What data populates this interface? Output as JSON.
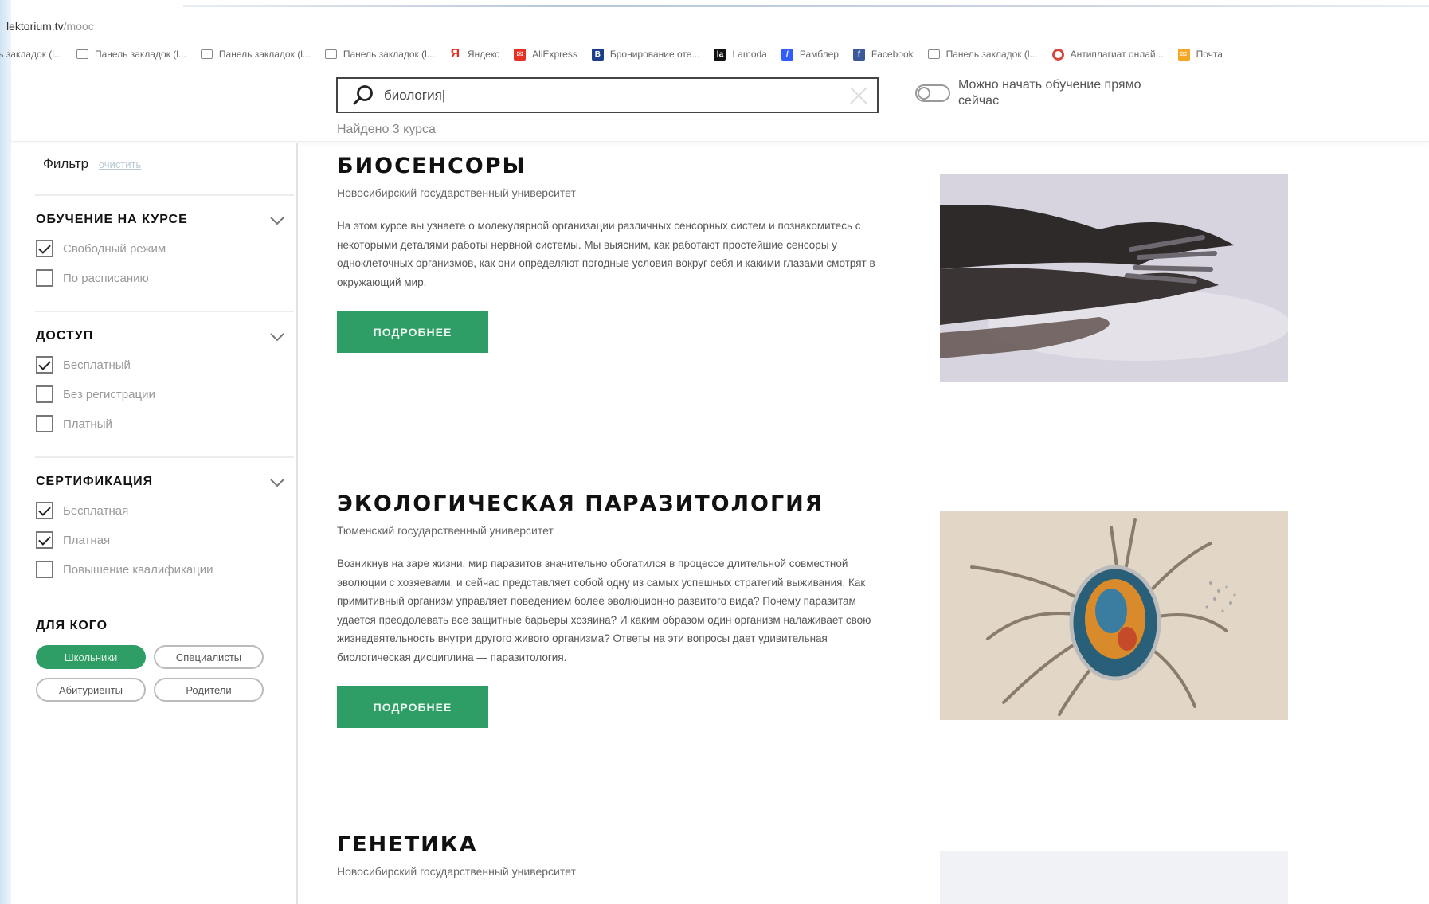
{
  "browser": {
    "url_host": "lektorium.tv",
    "url_path": "/mooc",
    "bookmarks": [
      {
        "icon": "folder-icon",
        "label": "Панель закладок (l..."
      },
      {
        "icon": "folder-icon",
        "label": "Панель закладок (l..."
      },
      {
        "icon": "folder-icon",
        "label": "Панель закладок (l..."
      },
      {
        "icon": "folder-icon",
        "label": "Панель закладок (l..."
      },
      {
        "icon": "yandex-icon",
        "label": "Яндекс"
      },
      {
        "icon": "aliexpress-icon",
        "label": "AliExpress"
      },
      {
        "icon": "booking-icon",
        "label": "Бронирование оте..."
      },
      {
        "icon": "lamoda-icon",
        "label": "Lamoda"
      },
      {
        "icon": "rambler-icon",
        "label": "Рамблер"
      },
      {
        "icon": "facebook-icon",
        "label": "Facebook"
      },
      {
        "icon": "folder-icon",
        "label": "Панель закладок (l..."
      },
      {
        "icon": "antiplagiat-icon",
        "label": "Антиплагиат онлай..."
      },
      {
        "icon": "mail-icon",
        "label": "Почта"
      }
    ]
  },
  "search": {
    "value": "биология|",
    "found_text": "Найдено 3 курса",
    "toggle_label": "Можно начать обучение прямо сейчас"
  },
  "filter": {
    "title": "Фильтр",
    "clear": "очистить",
    "sections": [
      {
        "title": "ОБУЧЕНИЕ НА КУРСЕ",
        "options": [
          {
            "label": "Свободный режим",
            "checked": true
          },
          {
            "label": "По расписанию",
            "checked": false
          }
        ]
      },
      {
        "title": "ДОСТУП",
        "options": [
          {
            "label": "Бесплатный",
            "checked": true
          },
          {
            "label": "Без регистрации",
            "checked": false
          },
          {
            "label": "Платный",
            "checked": false
          }
        ]
      },
      {
        "title": "СЕРТИФИКАЦИЯ",
        "options": [
          {
            "label": "Бесплатная",
            "checked": true
          },
          {
            "label": "Платная",
            "checked": true
          },
          {
            "label": "Повышение квалификации",
            "checked": false
          }
        ]
      }
    ],
    "audience": {
      "title": "ДЛЯ КОГО",
      "pills": [
        {
          "label": "Школьники",
          "active": true
        },
        {
          "label": "Специалисты",
          "active": false
        },
        {
          "label": "Абитуриенты",
          "active": false
        },
        {
          "label": "Родители",
          "active": false
        }
      ]
    }
  },
  "courses": [
    {
      "title": "БИОСЕНСОРЫ",
      "university": "Новосибирский государственный университет",
      "description": "На этом курсе вы узнаете о молекулярной организации различных сенсорных систем и познакомитесь с некоторыми деталями работы нервной системы. Мы выясним, как работают простейшие сенсоры у одноклеточных организмов, как они определяют погодные условия вокруг себя и какими глазами смотрят в окружающий мир.",
      "button": "ПОДРОБНЕЕ"
    },
    {
      "title": "ЭКОЛОГИЧЕСКАЯ ПАРАЗИТОЛОГИЯ",
      "university": "Тюменский государственный университет",
      "description": "Возникнув на заре жизни, мир паразитов значительно обогатился в процессе длительной совместной эволюции с хозяевами, и сейчас представляет собой одну из самых успешных стратегий выживания. Как примитивный организм управляет поведением более эволюционно развитого вида? Почему паразитам удается преодолевать все защитные барьеры хозяина? И каким образом один организм налаживает свою жизнедеятельность внутри другого живого организма? Ответы на эти вопросы дает удивительная биологическая дисциплина — паразитология.",
      "button": "ПОДРОБНЕЕ"
    },
    {
      "title": "ГЕНЕТИКА",
      "university": "Новосибирский государственный университет"
    }
  ]
}
